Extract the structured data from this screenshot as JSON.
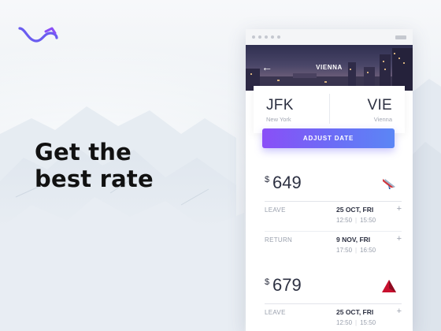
{
  "headline": {
    "line1": "Get the",
    "line2": "best rate"
  },
  "header": {
    "title": "VIENNA",
    "back_icon": "arrow-left-icon"
  },
  "route": {
    "from": {
      "code": "JFK",
      "city": "New York"
    },
    "to": {
      "code": "VIE",
      "city": "Vienna"
    }
  },
  "adjust_button": "ADJUST DATE",
  "offers": [
    {
      "currency": "$",
      "price": "649",
      "airline_icon": "american-airlines-icon",
      "legs": [
        {
          "label": "LEAVE",
          "date": "25 OCT, FRI",
          "depart": "12:50",
          "arrive": "15:50"
        },
        {
          "label": "RETURN",
          "date": "9 NOV, FRI",
          "depart": "17:50",
          "arrive": "16:50"
        }
      ]
    },
    {
      "currency": "$",
      "price": "679",
      "airline_icon": "delta-icon",
      "legs": [
        {
          "label": "LEAVE",
          "date": "25 OCT, FRI",
          "depart": "12:50",
          "arrive": "15:50"
        }
      ]
    }
  ],
  "colors": {
    "accent_start": "#8a4ff7",
    "accent_end": "#5b86f5",
    "logo": "#6a5cf0"
  }
}
